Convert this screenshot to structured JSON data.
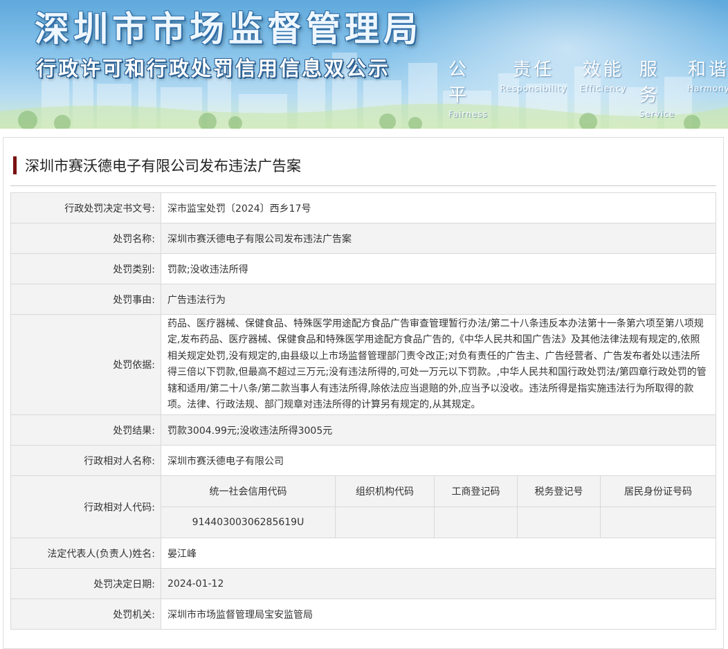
{
  "banner": {
    "title": "深圳市市场监督管理局",
    "subtitle": "行政许可和行政处罚信用信息双公示",
    "slogans": [
      {
        "cn": "公平",
        "en": "Fairness"
      },
      {
        "cn": "责任",
        "en": "Responsibility"
      },
      {
        "cn": "效能",
        "en": "Efficiency"
      },
      {
        "cn": "服务",
        "en": "Service"
      },
      {
        "cn": "和谐",
        "en": "Harmony"
      }
    ]
  },
  "page_title": "深圳市赛沃德电子有限公司发布违法广告案",
  "fields": {
    "decision_no": {
      "label": "行政处罚决定书文号:",
      "value": "深市监宝处罚〔2024〕西乡17号"
    },
    "name": {
      "label": "处罚名称:",
      "value": "深圳市赛沃德电子有限公司发布违法广告案"
    },
    "category": {
      "label": "处罚类别:",
      "value": "罚款;没收违法所得"
    },
    "reason": {
      "label": "处罚事由:",
      "value": "广告违法行为"
    },
    "basis": {
      "label": "处罚依据:",
      "value": "药品、医疗器械、保健食品、特殊医学用途配方食品广告审查管理暂行办法/第二十八条违反本办法第十一条第六项至第八项规定,发布药品、医疗器械、保健食品和特殊医学用途配方食品广告的,《中华人民共和国广告法》及其他法律法规有规定的,依照相关规定处罚,没有规定的,由县级以上市场监督管理部门责令改正;对负有责任的广告主、广告经营者、广告发布者处以违法所得三倍以下罚款,但最高不超过三万元;没有违法所得的,可处一万元以下罚款。,中华人民共和国行政处罚法/第四章行政处罚的管辖和适用/第二十八条/第二款当事人有违法所得,除依法应当退赔的外,应当予以没收。违法所得是指实施违法行为所取得的款项。法律、行政法规、部门规章对违法所得的计算另有规定的,从其规定。"
    },
    "result": {
      "label": "处罚结果:",
      "value": "罚款3004.99元;没收违法所得3005元"
    },
    "party_name": {
      "label": "行政相对人名称:",
      "value": "深圳市赛沃德电子有限公司"
    },
    "party_code": {
      "label": "行政相对人代码:",
      "headers": [
        "统一社会信用代码",
        "组织机构代码",
        "工商登记码",
        "税务登记号",
        "居民身份证号码"
      ],
      "values": [
        "91440300306285619U",
        "",
        "",
        "",
        ""
      ]
    },
    "legal_rep": {
      "label": "法定代表人(负责人)姓名:",
      "value": "晏江峰"
    },
    "decision_date": {
      "label": "处罚决定日期:",
      "value": "2024-01-12"
    },
    "authority": {
      "label": "处罚机关:",
      "value": "深圳市市场监督管理局宝安监管局"
    }
  },
  "colors": {
    "accent_bar": "#7a1111",
    "label_bg": "#f3f3f3",
    "border": "#d9d9d9"
  }
}
